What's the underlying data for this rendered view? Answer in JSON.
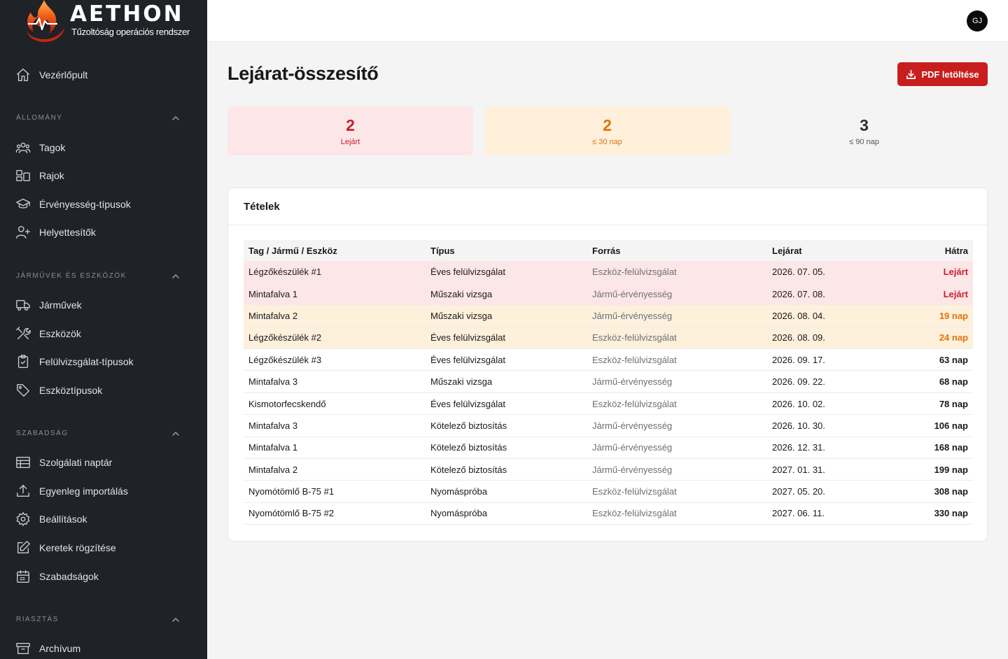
{
  "app": {
    "logo_title": "AETHON",
    "logo_subtitle": "Tűzoltóság operációs rendszer"
  },
  "sidebar": {
    "top_items": [
      {
        "label": "Vezérlőpult",
        "icon": "home-icon"
      }
    ],
    "sections": [
      {
        "title": "ÁLLOMÁNY",
        "items": [
          {
            "label": "Tagok",
            "icon": "users-icon"
          },
          {
            "label": "Rajok",
            "icon": "squads-icon"
          },
          {
            "label": "Érvényesség-típusok",
            "icon": "graduation-cap-icon"
          },
          {
            "label": "Helyettesítők",
            "icon": "user-plus-icon"
          }
        ]
      },
      {
        "title": "JÁRMŰVEK ÉS ESZKÖZÖK",
        "items": [
          {
            "label": "Járművek",
            "icon": "truck-icon"
          },
          {
            "label": "Eszközök",
            "icon": "tools-icon"
          },
          {
            "label": "Felülvizsgálat-típusok",
            "icon": "clipboard-check-icon"
          },
          {
            "label": "Eszköztípusok",
            "icon": "tag-icon"
          }
        ]
      },
      {
        "title": "SZABADSÁG",
        "items": [
          {
            "label": "Szolgálati naptár",
            "icon": "table-calendar-icon"
          },
          {
            "label": "Egyenleg importálás",
            "icon": "upload-icon"
          },
          {
            "label": "Beállítások",
            "icon": "gear-icon"
          },
          {
            "label": "Keretek rögzítése",
            "icon": "edit-icon"
          },
          {
            "label": "Szabadságok",
            "icon": "calendar-icon"
          }
        ]
      },
      {
        "title": "RIASZTÁS",
        "items": [
          {
            "label": "Archívum",
            "icon": "archive-icon"
          }
        ]
      }
    ]
  },
  "topbar": {
    "avatar_initials": "GJ"
  },
  "page": {
    "title": "Lejárat-összesítő",
    "pdf_button_label": "PDF letöltése"
  },
  "stats": [
    {
      "value": "2",
      "caption": "Lejárt",
      "color": "#c81e2e"
    },
    {
      "value": "2",
      "caption": "≤ 30 nap",
      "color": "#e0730a"
    },
    {
      "value": "3",
      "caption": "≤ 90 nap",
      "color": "#2c3036"
    }
  ],
  "items_card": {
    "title": "Tételek",
    "columns": [
      "Tag / Jármű / Eszköz",
      "Típus",
      "Forrás",
      "Lejárat",
      "Hátra"
    ],
    "rows": [
      {
        "name": "Légzőkészülék #1",
        "type": "Éves felülvizsgálat",
        "source": "Eszköz-felülvizsgálat",
        "expiry": "2026. 07. 05.",
        "remaining": "Lejárt",
        "status": "expired"
      },
      {
        "name": "Mintafalva 1",
        "type": "Műszaki vizsga",
        "source": "Jármű-érvényesség",
        "expiry": "2026. 07. 08.",
        "remaining": "Lejárt",
        "status": "expired"
      },
      {
        "name": "Mintafalva 2",
        "type": "Műszaki vizsga",
        "source": "Jármű-érvényesség",
        "expiry": "2026. 08. 04.",
        "remaining": "19 nap",
        "status": "soon"
      },
      {
        "name": "Légzőkészülék #2",
        "type": "Éves felülvizsgálat",
        "source": "Eszköz-felülvizsgálat",
        "expiry": "2026. 08. 09.",
        "remaining": "24 nap",
        "status": "soon"
      },
      {
        "name": "Légzőkészülék #3",
        "type": "Éves felülvizsgálat",
        "source": "Eszköz-felülvizsgálat",
        "expiry": "2026. 09. 17.",
        "remaining": "63 nap",
        "status": "normal"
      },
      {
        "name": "Mintafalva 3",
        "type": "Műszaki vizsga",
        "source": "Jármű-érvényesség",
        "expiry": "2026. 09. 22.",
        "remaining": "68 nap",
        "status": "normal"
      },
      {
        "name": "Kismotorfecskendő",
        "type": "Éves felülvizsgálat",
        "source": "Eszköz-felülvizsgálat",
        "expiry": "2026. 10. 02.",
        "remaining": "78 nap",
        "status": "normal"
      },
      {
        "name": "Mintafalva 3",
        "type": "Kötelező biztosítás",
        "source": "Jármű-érvényesség",
        "expiry": "2026. 10. 30.",
        "remaining": "106 nap",
        "status": "normal"
      },
      {
        "name": "Mintafalva 1",
        "type": "Kötelező biztosítás",
        "source": "Jármű-érvényesség",
        "expiry": "2026. 12. 31.",
        "remaining": "168 nap",
        "status": "normal"
      },
      {
        "name": "Mintafalva 2",
        "type": "Kötelező biztosítás",
        "source": "Jármű-érvényesség",
        "expiry": "2027. 01. 31.",
        "remaining": "199 nap",
        "status": "normal"
      },
      {
        "name": "Nyomótömlő B-75 #1",
        "type": "Nyomáspróba",
        "source": "Eszköz-felülvizsgálat",
        "expiry": "2027. 05. 20.",
        "remaining": "308 nap",
        "status": "normal"
      },
      {
        "name": "Nyomótömlő B-75 #2",
        "type": "Nyomáspróba",
        "source": "Eszköz-felülvizsgálat",
        "expiry": "2027. 06. 11.",
        "remaining": "330 nap",
        "status": "normal"
      }
    ]
  },
  "colors": {
    "sidebar_bg": "#1f2227",
    "accent_red": "#c81e1e",
    "expired_bg": "#fde6e7",
    "soon_bg": "#fef0db"
  }
}
